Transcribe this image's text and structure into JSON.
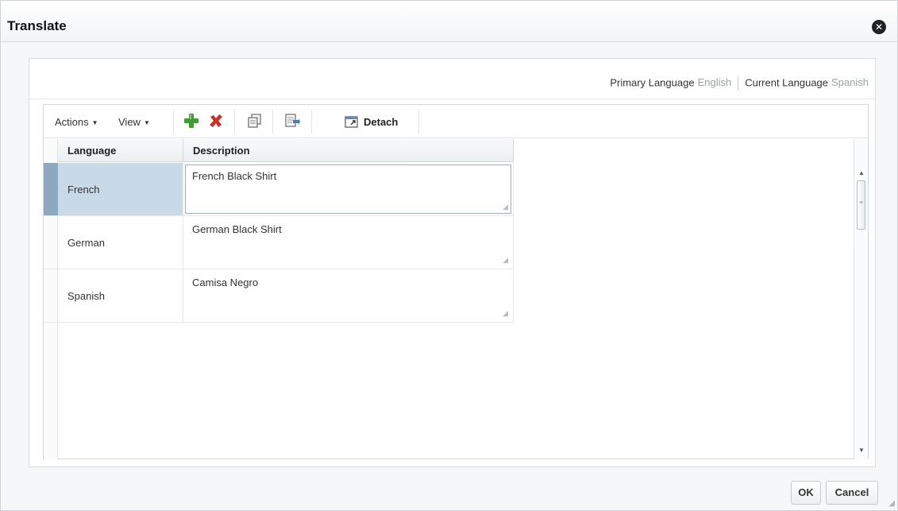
{
  "dialog": {
    "title": "Translate",
    "close_icon": "close-icon"
  },
  "languages": {
    "primary_label": "Primary Language",
    "primary_value": "English",
    "current_label": "Current Language",
    "current_value": "Spanish"
  },
  "toolbar": {
    "actions_label": "Actions",
    "view_label": "View",
    "detach_label": "Detach",
    "icons": [
      "add-icon",
      "delete-icon",
      "duplicate-icon",
      "export-icon",
      "detach-icon"
    ],
    "colors": {
      "add": "#3aa12e",
      "delete": "#d42a1f"
    }
  },
  "table": {
    "columns": [
      "Language",
      "Description"
    ],
    "rows": [
      {
        "language": "French",
        "description": "French Black Shirt",
        "selected": true
      },
      {
        "language": "German",
        "description": "German Black Shirt",
        "selected": false
      },
      {
        "language": "Spanish",
        "description": "Camisa Negro",
        "selected": false
      }
    ]
  },
  "footer": {
    "ok_label": "OK",
    "cancel_label": "Cancel"
  }
}
